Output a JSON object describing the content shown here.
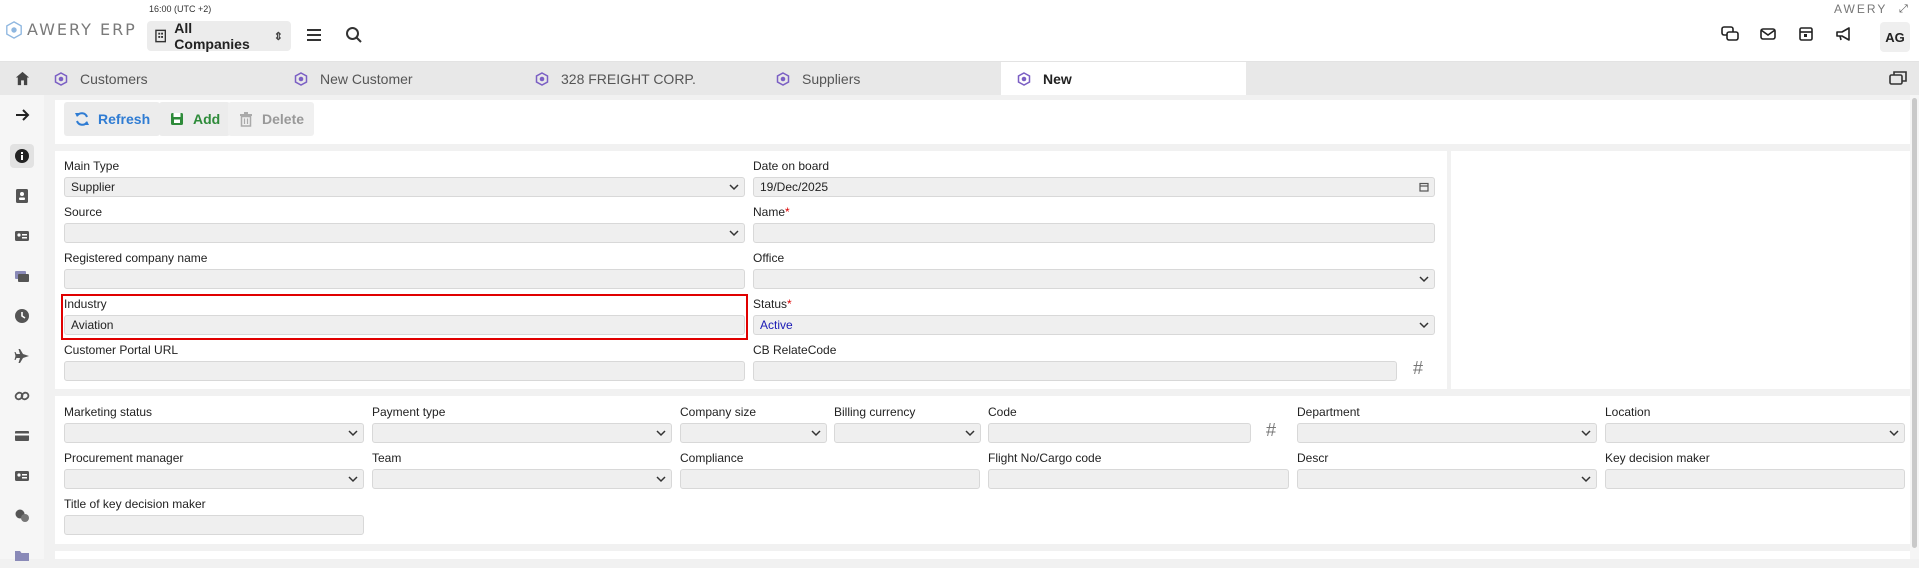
{
  "app": {
    "logo_text": "AWERY ERP",
    "brand_right": "AWERY",
    "clock": "16:00 (UTC +2)",
    "company_selector": "All Companies",
    "avatar_initials": "AG"
  },
  "tabs": [
    {
      "label": "Customers"
    },
    {
      "label": "New Customer"
    },
    {
      "label": "328 FREIGHT CORP."
    },
    {
      "label": "Suppliers"
    },
    {
      "label": "New"
    }
  ],
  "toolbar": {
    "refresh_label": "Refresh",
    "add_label": "Add",
    "delete_label": "Delete"
  },
  "form": {
    "main_type": {
      "label": "Main Type",
      "value": "Supplier"
    },
    "date_on_board": {
      "label": "Date on board",
      "value": "19/Dec/2025"
    },
    "source": {
      "label": "Source",
      "value": ""
    },
    "name": {
      "label": "Name",
      "value": ""
    },
    "registered_company_name": {
      "label": "Registered company name",
      "value": ""
    },
    "office": {
      "label": "Office",
      "value": ""
    },
    "industry": {
      "label": "Industry",
      "value": "Aviation"
    },
    "status": {
      "label": "Status",
      "value": "Active"
    },
    "customer_portal_url": {
      "label": "Customer Portal URL",
      "value": ""
    },
    "cb_relatecode": {
      "label": "CB RelateCode",
      "value": ""
    }
  },
  "details": {
    "marketing_status": {
      "label": "Marketing status",
      "value": ""
    },
    "payment_type": {
      "label": "Payment type",
      "value": ""
    },
    "company_size": {
      "label": "Company size",
      "value": ""
    },
    "billing_currency": {
      "label": "Billing currency",
      "value": ""
    },
    "code": {
      "label": "Code",
      "value": ""
    },
    "department": {
      "label": "Department",
      "value": ""
    },
    "location": {
      "label": "Location",
      "value": ""
    },
    "procurement_manager": {
      "label": "Procurement manager",
      "value": ""
    },
    "team": {
      "label": "Team",
      "value": ""
    },
    "compliance": {
      "label": "Compliance",
      "value": ""
    },
    "flight_no": {
      "label": "Flight No/Cargo code",
      "value": ""
    },
    "descr": {
      "label": "Descr",
      "value": ""
    },
    "key_decision_maker": {
      "label": "Key decision maker",
      "value": ""
    },
    "title_key_decision_maker": {
      "label": "Title of key decision maker",
      "value": ""
    }
  },
  "colors": {
    "accent_blue": "#2f7cd3",
    "add_green": "#2e8b3a",
    "tab_hex_purple": "#7b5fc4",
    "required_red": "#d00000",
    "highlight_red": "#e00000",
    "status_blue": "#1a1ab5"
  }
}
